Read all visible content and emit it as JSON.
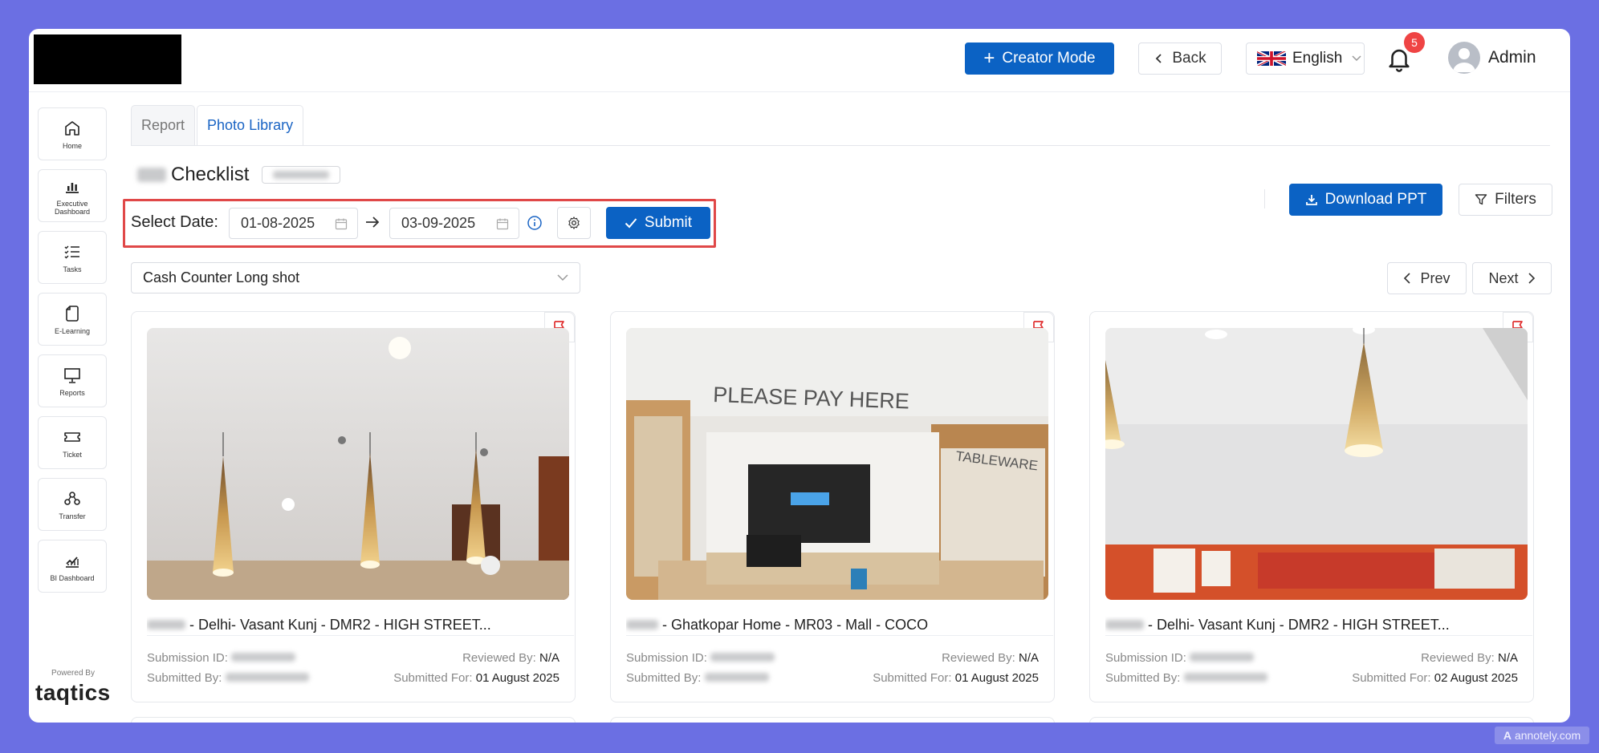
{
  "header": {
    "creator_mode": "Creator Mode",
    "back": "Back",
    "language": "English",
    "notifications_count": "5",
    "user": "Admin"
  },
  "sidebar": {
    "items": [
      {
        "label": "Home",
        "icon": "home-icon"
      },
      {
        "label": "Executive Dashboard",
        "icon": "bar-chart-icon"
      },
      {
        "label": "Tasks",
        "icon": "task-list-icon"
      },
      {
        "label": "E-Learning",
        "icon": "document-icon"
      },
      {
        "label": "Reports",
        "icon": "presentation-icon"
      },
      {
        "label": "Ticket",
        "icon": "ticket-icon"
      },
      {
        "label": "Transfer",
        "icon": "transfer-icon"
      },
      {
        "label": "BI Dashboard",
        "icon": "line-chart-icon"
      }
    ],
    "powered_by": "Powered By",
    "brand": "taqtics"
  },
  "tabs": [
    {
      "label": "Report",
      "active": false
    },
    {
      "label": "Photo Library",
      "active": true
    }
  ],
  "page": {
    "title": "Checklist",
    "select_date_label": "Select Date:",
    "start_date": "01-08-2025",
    "end_date": "03-09-2025",
    "submit": "Submit",
    "download_ppt": "Download PPT",
    "filters": "Filters",
    "question_select": "Cash Counter Long shot",
    "prev": "Prev",
    "next": "Next"
  },
  "cards": [
    {
      "store": "- Delhi- Vasant Kunj - DMR2 - HIGH STREET...",
      "submission_id_label": "Submission ID:",
      "submitted_by_label": "Submitted By:",
      "reviewed_by_label": "Reviewed By:",
      "reviewed_by": "N/A",
      "submitted_for_label": "Submitted For:",
      "submitted_for": "01 August 2025"
    },
    {
      "store": "- Ghatkopar Home - MR03 - Mall - COCO",
      "submission_id_label": "Submission ID:",
      "submitted_by_label": "Submitted By:",
      "reviewed_by_label": "Reviewed By:",
      "reviewed_by": "N/A",
      "submitted_for_label": "Submitted For:",
      "submitted_for": "01 August 2025"
    },
    {
      "store": "- Delhi- Vasant Kunj - DMR2 - HIGH STREET...",
      "submission_id_label": "Submission ID:",
      "submitted_by_label": "Submitted By:",
      "reviewed_by_label": "Reviewed By:",
      "reviewed_by": "N/A",
      "submitted_for_label": "Submitted For:",
      "submitted_for": "02 August 2025"
    }
  ],
  "photo_texts": {
    "sign": "PLEASE PAY HERE",
    "tableware": "TABLEWARE"
  },
  "watermark": "annotely.com",
  "colors": {
    "background": "#6b6fe3",
    "primary": "#0b62c4",
    "highlight_border": "#e04848",
    "badge": "#ef4444"
  }
}
